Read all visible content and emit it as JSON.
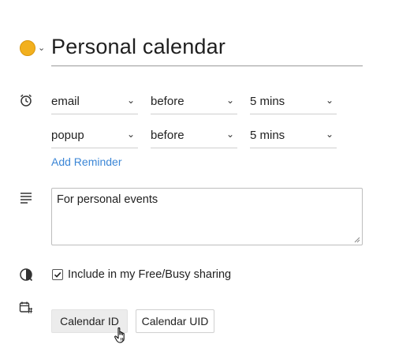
{
  "header": {
    "title": "Personal calendar",
    "calendar_color": "#f2b01e",
    "color_dropdown_icon": "chevron-down-icon"
  },
  "reminders": {
    "icon": "alarm-clock-icon",
    "items": [
      {
        "method": "email",
        "relation": "before",
        "time": "5 mins"
      },
      {
        "method": "popup",
        "relation": "before",
        "time": "5 mins"
      }
    ],
    "add_label": "Add Reminder",
    "link_color": "#3b86d6"
  },
  "description": {
    "icon": "description-lines-icon",
    "value": "For personal events"
  },
  "freebusy": {
    "icon": "availability-icon",
    "label": "Include in my Free/Busy sharing",
    "checked": true
  },
  "calendar_identity": {
    "icon": "calendar-hash-icon",
    "buttons": {
      "id": "Calendar ID",
      "uid": "Calendar UID"
    }
  },
  "cursor": "hand-pointer-icon"
}
